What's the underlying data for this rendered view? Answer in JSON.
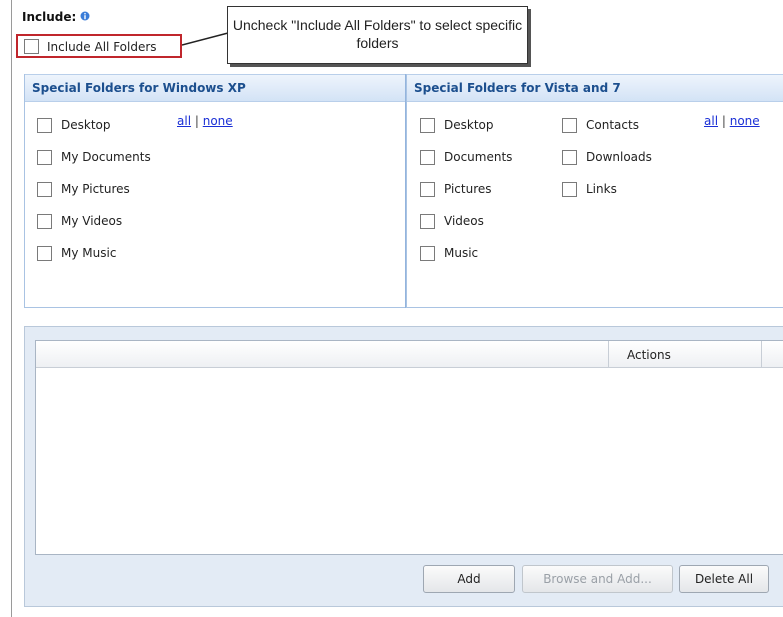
{
  "include": {
    "label": "Include:",
    "include_all_label": "Include All Folders",
    "include_all_checked": false
  },
  "callout": {
    "text": "Uncheck \"Include All Folders\" to select specific folders"
  },
  "xp_panel": {
    "title": "Special Folders for Windows XP",
    "links": {
      "all": "all",
      "separator": "|",
      "none": "none"
    },
    "items": [
      {
        "label": "Desktop",
        "checked": false
      },
      {
        "label": "My Documents",
        "checked": false
      },
      {
        "label": "My Pictures",
        "checked": false
      },
      {
        "label": "My Videos",
        "checked": false
      },
      {
        "label": "My Music",
        "checked": false
      }
    ]
  },
  "vista_panel": {
    "title": "Special Folders for Vista and 7",
    "links": {
      "all": "all",
      "separator": "|",
      "none": "none"
    },
    "items": [
      {
        "label": "Desktop",
        "checked": false
      },
      {
        "label": "Documents",
        "checked": false
      },
      {
        "label": "Pictures",
        "checked": false
      },
      {
        "label": "Videos",
        "checked": false
      },
      {
        "label": "Music",
        "checked": false
      },
      {
        "label": "Contacts",
        "checked": false
      },
      {
        "label": "Downloads",
        "checked": false
      },
      {
        "label": "Links",
        "checked": false
      }
    ]
  },
  "folder_list": {
    "columns": [
      "",
      "Actions"
    ],
    "rows": []
  },
  "buttons": {
    "add": "Add",
    "browse_and_add": "Browse and Add...",
    "delete_all": "Delete All"
  },
  "colors": {
    "highlight_border": "#c0262c",
    "panel_title": "#1c4f8e",
    "link": "#1a2fd6"
  }
}
